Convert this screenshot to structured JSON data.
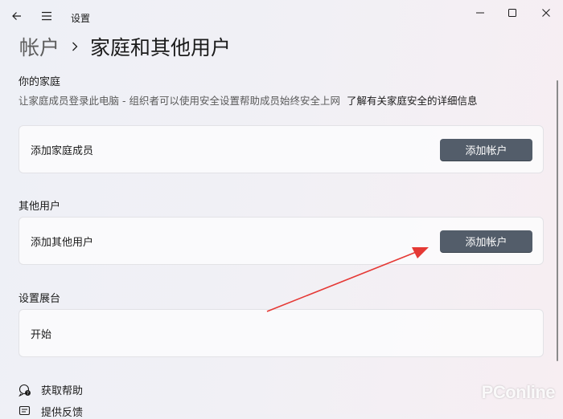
{
  "window": {
    "app_title": "设置",
    "controls": [
      "minimize",
      "maximize",
      "close"
    ]
  },
  "breadcrumb": {
    "parent": "帐户",
    "current": "家庭和其他用户"
  },
  "family": {
    "title": "你的家庭",
    "description": "让家庭成员登录此电脑 - 组织者可以使用安全设置帮助成员始终安全上网",
    "learn_more_link": "了解有关家庭安全的详细信息",
    "add_member_label": "添加家庭成员",
    "add_account_button": "添加帐户"
  },
  "other_users": {
    "title": "其他用户",
    "add_other_label": "添加其他用户",
    "add_account_button": "添加帐户"
  },
  "kiosk": {
    "title": "设置展台",
    "start_label": "开始"
  },
  "footer_links": {
    "get_help": "获取帮助",
    "feedback": "提供反馈"
  },
  "watermark": "PConline",
  "colors": {
    "button_bg": "#535d6a",
    "annotation_arrow": "#e53935"
  }
}
